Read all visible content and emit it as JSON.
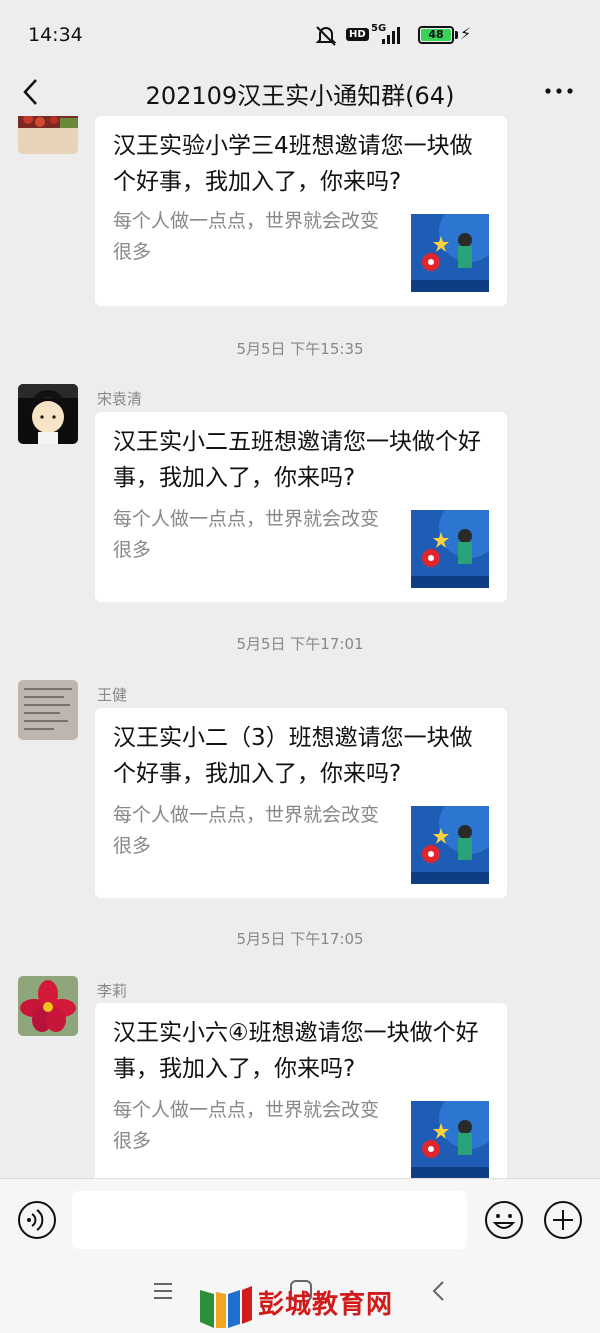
{
  "status": {
    "time": "14:34",
    "hd": "HD",
    "network": "5G",
    "battery": "48"
  },
  "header": {
    "title": "202109汉王实小通知群(64)"
  },
  "messages": [
    {
      "sender": "",
      "title": "汉王实验小学三4班想邀请您一块做个好事，我加入了，你来吗?",
      "desc": "每个人做一点点，世界就会改变很多"
    },
    {
      "timestamp": "5月5日 下午15:35",
      "sender": "宋袁清",
      "title": "汉王实小二五班想邀请您一块做个好事，我加入了，你来吗?",
      "desc": "每个人做一点点，世界就会改变很多"
    },
    {
      "timestamp": "5月5日 下午17:01",
      "sender": "王健",
      "title": "汉王实小二（3）班想邀请您一块做个好事，我加入了，你来吗?",
      "desc": "每个人做一点点，世界就会改变很多"
    },
    {
      "timestamp": "5月5日 下午17:05",
      "sender": "李莉",
      "title": "汉王实小六④班想邀请您一块做个好事，我加入了，你来吗?",
      "desc": "每个人做一点点，世界就会改变很多"
    }
  ],
  "watermark": {
    "text": "彭城教育网"
  },
  "colors": {
    "background": "#ededed",
    "bubble": "#ffffff",
    "watermark": "#d11a1a",
    "battery": "#3ad15a"
  }
}
